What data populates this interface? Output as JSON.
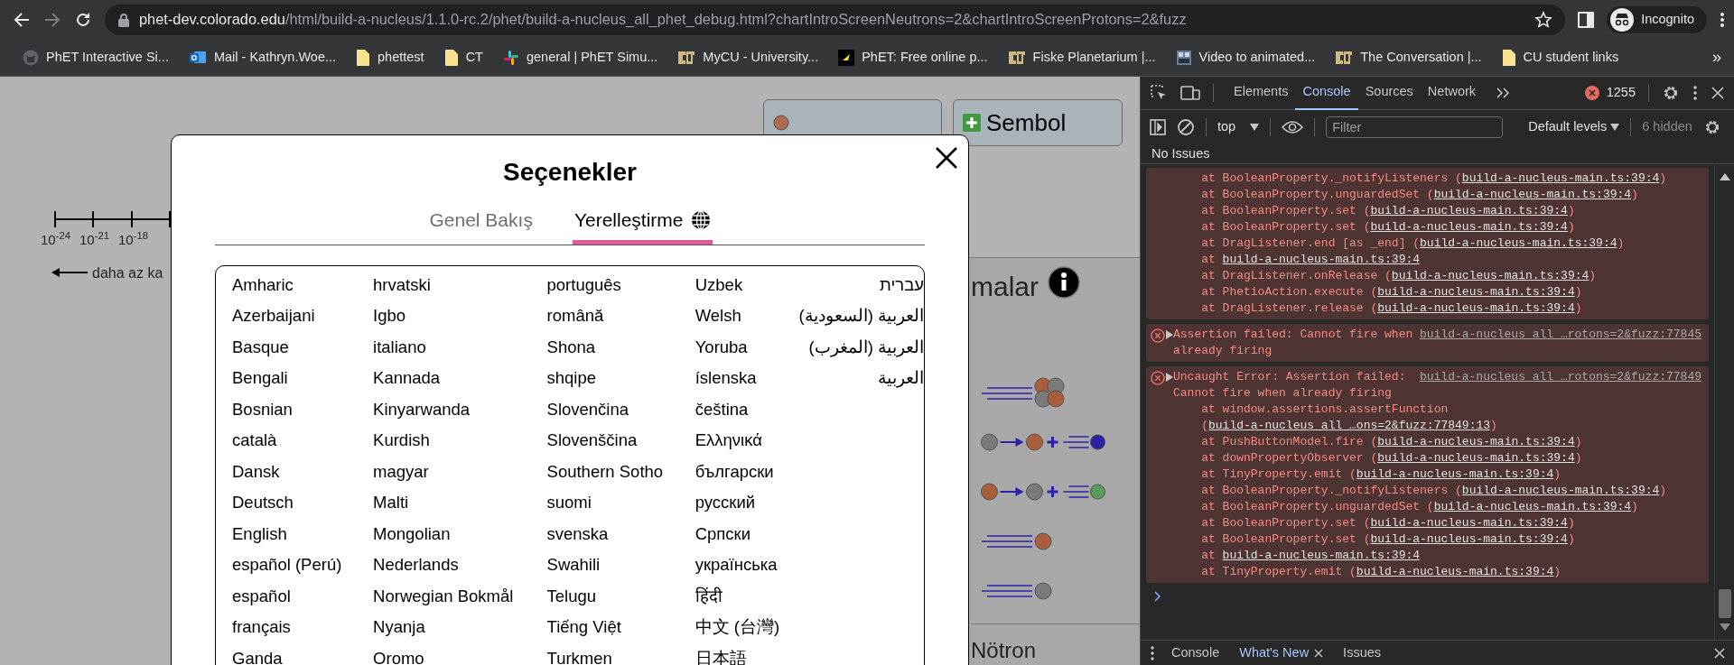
{
  "browser": {
    "url_host": "phet-dev.colorado.edu",
    "url_path": "/html/build-a-nucleus/1.1.0-rc.2/phet/build-a-nucleus_all_phet_debug.html?chartIntroScreenNeutrons=2&chartIntroScreenProtons=2&fuzz",
    "profile": "Incognito"
  },
  "bookmarks": [
    {
      "label": "PhET Interactive Si...",
      "kind": "github"
    },
    {
      "label": "Mail - Kathryn.Woe...",
      "kind": "mail"
    },
    {
      "label": "phettest",
      "kind": "folder"
    },
    {
      "label": "CT",
      "kind": "folder"
    },
    {
      "label": "general | PhET Simu...",
      "kind": "slack"
    },
    {
      "label": "MyCU - University...",
      "kind": "cu"
    },
    {
      "label": "PhET: Free online p...",
      "kind": "phet"
    },
    {
      "label": "Fiske Planetarium |...",
      "kind": "cu"
    },
    {
      "label": "Video to animated...",
      "kind": "gif"
    },
    {
      "label": "The Conversation |...",
      "kind": "cu"
    },
    {
      "label": "CU student links",
      "kind": "folder"
    }
  ],
  "bookmarks_more": "»",
  "sim": {
    "scale_labels": [
      "10$^{-24}$",
      "10$^{-21}$",
      "10$^{-18}$"
    ],
    "arrow_label": "daha az ka",
    "symbol_button": "Sembol",
    "panel_title": "malar",
    "panel_rows": [
      {
        "kind": "alpha"
      },
      {
        "kind": "beta-minus"
      },
      {
        "kind": "beta-plus"
      },
      {
        "kind": "proton"
      },
      {
        "kind": "neutron"
      }
    ],
    "panel_footer": "Nötron"
  },
  "dialog": {
    "title": "Seçenekler",
    "tabs": [
      {
        "label": "Genel Bakış",
        "selected": false,
        "kind": "overview"
      },
      {
        "label": "Yerelleştirme",
        "selected": true,
        "kind": "localization"
      }
    ],
    "language_columns": [
      [
        "Amharic",
        "Azerbaijani",
        "Basque",
        "Bengali",
        "Bosnian",
        "català",
        "Dansk",
        "Deutsch",
        "English",
        "español (Perú)",
        "español",
        "français",
        "Ganda"
      ],
      [
        "hrvatski",
        "Igbo",
        "italiano",
        "Kannada",
        "Kinyarwanda",
        "Kurdish",
        "magyar",
        "Malti",
        "Mongolian",
        "Nederlands",
        "Norwegian Bokmål",
        "Nyanja",
        "Oromo"
      ],
      [
        "português",
        "română",
        "Shona",
        "shqipe",
        "Slovenčina",
        "Slovenščina",
        "Southern Sotho",
        "suomi",
        "svenska",
        "Swahili",
        "Telugu",
        "Tiếng Việt",
        "Turkmen"
      ],
      [
        "Uzbek",
        "Welsh",
        "Yoruba",
        "íslenska",
        "čeština",
        "Ελληνικά",
        "български",
        "русский",
        "Српски",
        "українська",
        "हिंदी",
        "中文 (台灣)",
        "日本語"
      ],
      [
        "עברית",
        "العربية (السعودية)",
        "العربية (المغرب)",
        "العربية"
      ]
    ]
  },
  "devtools": {
    "tabs": [
      {
        "label": "Elements",
        "selected": false
      },
      {
        "label": "Console",
        "selected": true
      },
      {
        "label": "Sources",
        "selected": false
      },
      {
        "label": "Network",
        "selected": false
      }
    ],
    "error_count": "1255",
    "context": "top",
    "filter_placeholder": "Filter",
    "levels": "Default levels",
    "hidden": "6 hidden",
    "issues": "No Issues",
    "messages": [
      {
        "kind": "stack",
        "lines": [
          {
            "text": "at BooleanProperty._notifyListeners (",
            "link": "build-a-nucleus-main.ts:39:4",
            "end": ")"
          },
          {
            "text": "at BooleanProperty.unguardedSet (",
            "link": "build-a-nucleus-main.ts:39:4",
            "end": ")"
          },
          {
            "text": "at BooleanProperty.set (",
            "link": "build-a-nucleus-main.ts:39:4",
            "end": ")"
          },
          {
            "text": "at BooleanProperty.set (",
            "link": "build-a-nucleus-main.ts:39:4",
            "end": ")"
          },
          {
            "text": "at DragListener.end [as _end] (",
            "link": "build-a-nucleus-main.ts:39:4",
            "end": ")"
          },
          {
            "text": "at ",
            "link": "build-a-nucleus-main.ts:39:4"
          },
          {
            "text": "at DragListener.onRelease (",
            "link": "build-a-nucleus-main.ts:39:4",
            "end": ")"
          },
          {
            "text": "at PhetioAction.execute (",
            "link": "build-a-nucleus-main.ts:39:4",
            "end": ")"
          },
          {
            "text": "at DragListener.release (",
            "link": "build-a-nucleus-main.ts:39:4",
            "end": ")"
          }
        ]
      },
      {
        "kind": "error",
        "message": "Assertion failed:  Cannot fire when already firing",
        "source": "build-a-nucleus_all_…rotons=2&fuzz:77845"
      },
      {
        "kind": "error",
        "message": "Uncaught Error: Assertion failed: Cannot fire when already firing",
        "source": "build-a-nucleus_all_…rotons=2&fuzz:77849",
        "lines": [
          {
            "text": "at window.assertions.assertFunction (",
            "link": "build-a-nucleus_all_…ons=2&fuzz:77849:13",
            "end": ")"
          },
          {
            "text": "at PushButtonModel.fire (",
            "link": "build-a-nucleus-main.ts:39:4",
            "end": ")"
          },
          {
            "text": "at downPropertyObserver (",
            "link": "build-a-nucleus-main.ts:39:4",
            "end": ")"
          },
          {
            "text": "at TinyProperty.emit (",
            "link": "build-a-nucleus-main.ts:39:4",
            "end": ")"
          },
          {
            "text": "at BooleanProperty._notifyListeners (",
            "link": "build-a-nucleus-main.ts:39:4",
            "end": ")"
          },
          {
            "text": "at BooleanProperty.unguardedSet (",
            "link": "build-a-nucleus-main.ts:39:4",
            "end": ")"
          },
          {
            "text": "at BooleanProperty.set (",
            "link": "build-a-nucleus-main.ts:39:4",
            "end": ")"
          },
          {
            "text": "at BooleanProperty.set (",
            "link": "build-a-nucleus-main.ts:39:4",
            "end": ")"
          },
          {
            "text": "at ",
            "link": "build-a-nucleus-main.ts:39:4"
          },
          {
            "text": "at TinyProperty.emit (",
            "link": "build-a-nucleus-main.ts:39:4",
            "end": ")"
          }
        ]
      }
    ],
    "drawer_tabs": [
      {
        "label": "Console",
        "selected": false,
        "closable": false
      },
      {
        "label": "What's New",
        "selected": true,
        "closable": true
      },
      {
        "label": "Issues",
        "selected": false,
        "closable": false
      }
    ]
  }
}
